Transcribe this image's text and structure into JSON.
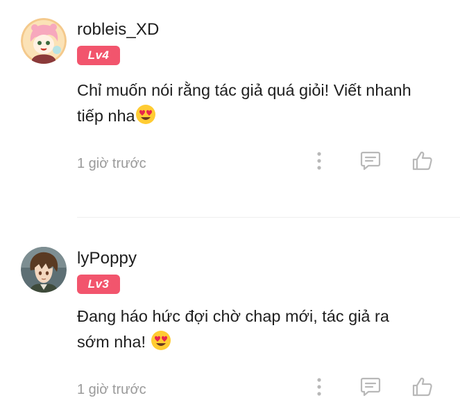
{
  "comments": [
    {
      "username": "robleis_XD",
      "level": "Lv4",
      "text_line1": "Chỉ muốn nói rằng tác giả quá giỏi! Viết nhanh",
      "text_line2": "tiếp nha",
      "emoji": "heart-eyes-emoji",
      "timestamp": "1 giờ trước",
      "avatar": "anime-girl-pink-hair-avatar"
    },
    {
      "username": "lyPoppy",
      "level": "Lv3",
      "text_line1": "Đang háo hức đợi chờ chap mới, tác giả ra",
      "text_line2": "sớm nha! ",
      "emoji": "heart-eyes-emoji",
      "timestamp": "1 giờ trước",
      "avatar": "anime-boy-brown-hair-avatar"
    }
  ],
  "icons": {
    "more": "more-vertical-icon",
    "reply": "comment-reply-icon",
    "like": "thumbs-up-icon"
  },
  "colors": {
    "badge": "#f2556d",
    "icon": "#b8b8b8",
    "timestamp": "#9a9a9a",
    "divider": "#eeeeee"
  }
}
